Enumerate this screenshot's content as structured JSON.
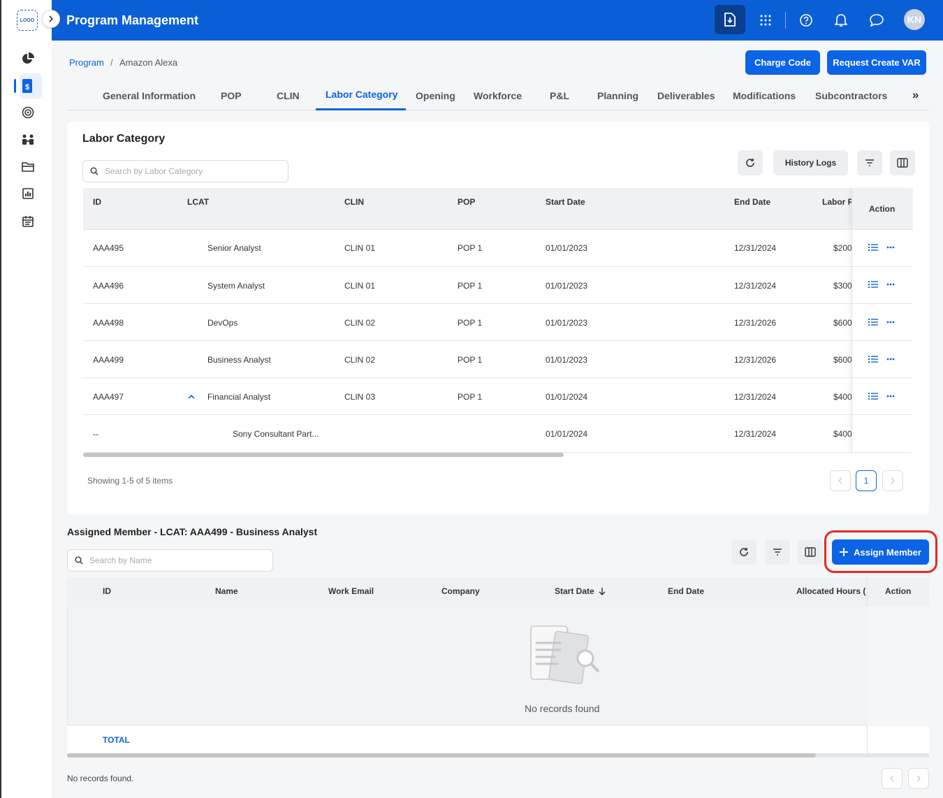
{
  "sidebar": {
    "logo": "LOGO",
    "items": [
      "dashboard-pie-icon",
      "programs-icon",
      "target-icon",
      "people-icon",
      "folder-icon",
      "reports-icon",
      "calendar-icon"
    ]
  },
  "header": {
    "title": "Program Management",
    "avatar": "KN"
  },
  "breadcrumb": {
    "root": "Program",
    "sep": "/",
    "current": "Amazon Alexa"
  },
  "actions": {
    "charge_code": "Charge Code",
    "request_var": "Request Create VAR"
  },
  "tabs": [
    "General Information",
    "POP",
    "CLIN",
    "Labor Category",
    "Opening",
    "Workforce",
    "P&L",
    "Planning",
    "Deliverables",
    "Modifications",
    "Subcontractors"
  ],
  "tabs_more": "»",
  "labor": {
    "title": "Labor Category",
    "search_placeholder": "Search by Labor Category",
    "history_logs": "History Logs",
    "columns": {
      "id": "ID",
      "lcat": "LCAT",
      "clin": "CLIN",
      "pop": "POP",
      "start": "Start Date",
      "end": "End Date",
      "rate": "Labor R",
      "action": "Action"
    },
    "rows": [
      {
        "id": "AAA495",
        "lcat": "Senior Analyst",
        "clin": "CLIN 01",
        "pop": "POP 1",
        "start": "01/01/2023",
        "end": "12/31/2024",
        "rate": "$200"
      },
      {
        "id": "AAA496",
        "lcat": "System Analyst",
        "clin": "CLIN 01",
        "pop": "POP 1",
        "start": "01/01/2023",
        "end": "12/31/2024",
        "rate": "$300"
      },
      {
        "id": "AAA498",
        "lcat": "DevOps",
        "clin": "CLIN 02",
        "pop": "POP 1",
        "start": "01/01/2023",
        "end": "12/31/2026",
        "rate": "$600"
      },
      {
        "id": "AAA499",
        "lcat": "Business Analyst",
        "clin": "CLIN 02",
        "pop": "POP 1",
        "start": "01/01/2023",
        "end": "12/31/2026",
        "rate": "$600"
      },
      {
        "id": "AAA497",
        "lcat": "Financial Analyst",
        "clin": "CLIN 03",
        "pop": "POP 1",
        "start": "01/01/2024",
        "end": "12/31/2024",
        "rate": "$400"
      }
    ],
    "subrow": {
      "id": "--",
      "lcat": "Sony Consultant Part...",
      "start": "01/01/2024",
      "end": "12/31/2024",
      "rate": "$400"
    },
    "showing": "Showing 1-5 of 5 items",
    "page": "1"
  },
  "assigned": {
    "title": "Assigned Member - LCAT: AAA499 - Business Analyst",
    "search_placeholder": "Search by Name",
    "assign_button": "Assign Member",
    "columns": {
      "id": "ID",
      "name": "Name",
      "email": "Work Email",
      "company": "Company",
      "start": "Start Date",
      "end": "End Date",
      "hours": "Allocated Hours (I",
      "action": "Action"
    },
    "empty": "No records found",
    "total": "TOTAL",
    "footer": "No records found."
  }
}
